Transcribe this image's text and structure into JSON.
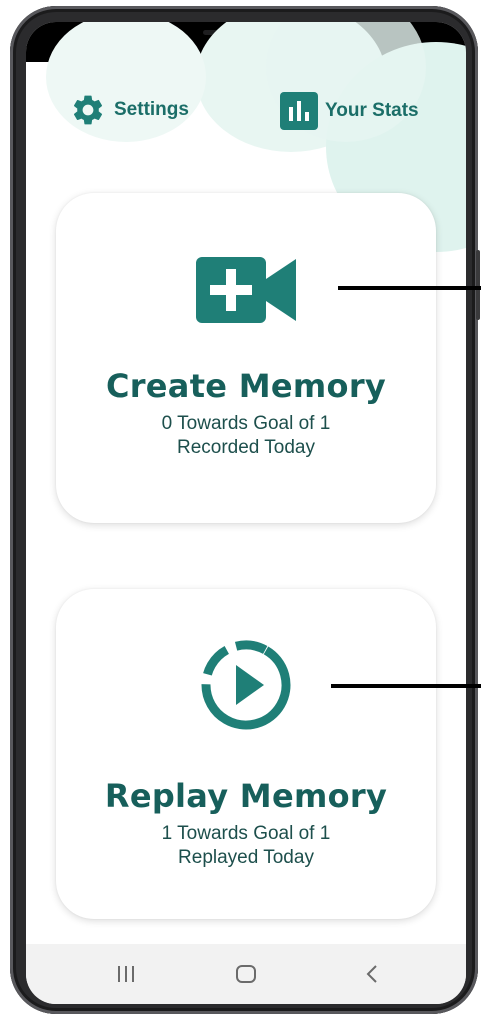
{
  "header": {
    "settings_label": "Settings",
    "stats_label": "Your Stats"
  },
  "cards": [
    {
      "title": "Create Memory",
      "line1": "0 Towards Goal of 1",
      "line2": "Recorded Today",
      "icon": "video-plus-icon"
    },
    {
      "title": "Replay Memory",
      "line1": "1 Towards Goal of 1",
      "line2": "Replayed Today",
      "icon": "replay-play-icon"
    }
  ],
  "navbar": {
    "items": [
      "recent-apps",
      "home",
      "back"
    ]
  },
  "colors": {
    "accent": "#1f7f77",
    "text_dark": "#175f5b",
    "blob": "#dff3ee"
  }
}
